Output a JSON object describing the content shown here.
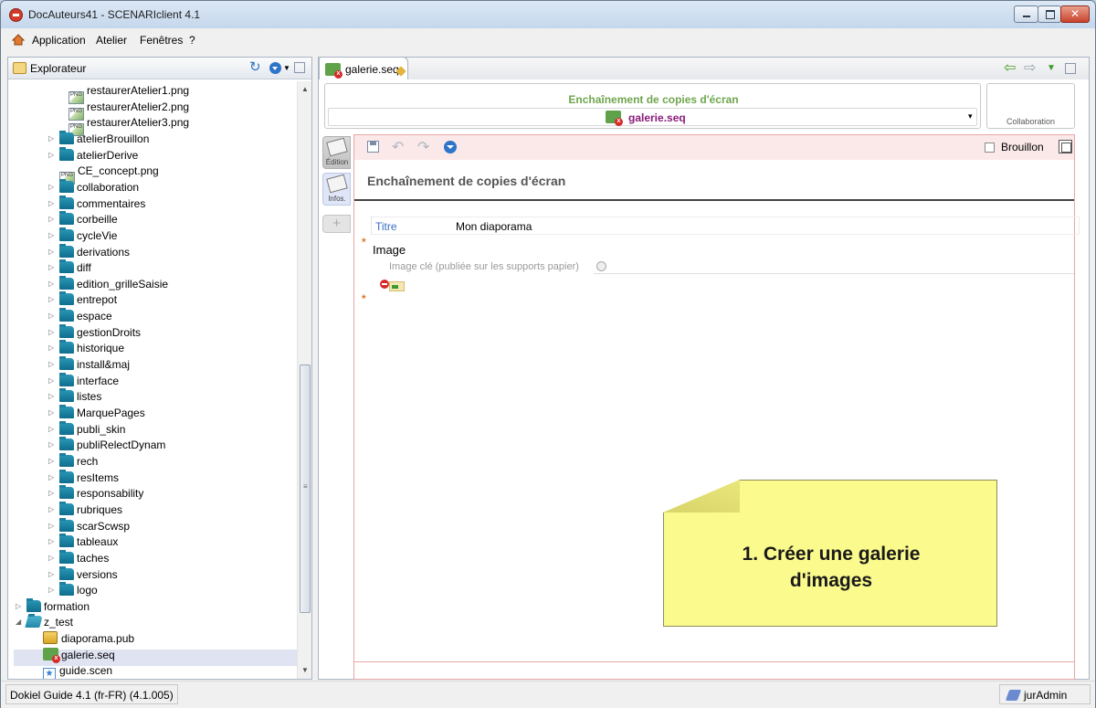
{
  "window": {
    "title": "DocAuteurs41 - SCENARIclient 4.1",
    "close_glyph": "✕"
  },
  "menu": [
    "Application",
    "Atelier",
    "Fenêtres",
    "?"
  ],
  "explorer": {
    "title": "Explorateur",
    "tree": [
      {
        "label": "restaurerAtelier1.png",
        "type": "png",
        "level": 4,
        "twisty": ""
      },
      {
        "label": "restaurerAtelier2.png",
        "type": "png",
        "level": 4,
        "twisty": ""
      },
      {
        "label": "restaurerAtelier3.png",
        "type": "png",
        "level": 4,
        "twisty": ""
      },
      {
        "label": "atelierBrouillon",
        "type": "folder",
        "level": 3,
        "twisty": "▷"
      },
      {
        "label": "atelierDerive",
        "type": "folder",
        "level": 3,
        "twisty": "▷"
      },
      {
        "label": "CE_concept.png",
        "type": "png",
        "level": 3,
        "twisty": ""
      },
      {
        "label": "collaboration",
        "type": "folder",
        "level": 3,
        "twisty": "▷"
      },
      {
        "label": "commentaires",
        "type": "folder",
        "level": 3,
        "twisty": "▷"
      },
      {
        "label": "corbeille",
        "type": "folder",
        "level": 3,
        "twisty": "▷"
      },
      {
        "label": "cycleVie",
        "type": "folder",
        "level": 3,
        "twisty": "▷"
      },
      {
        "label": "derivations",
        "type": "folder",
        "level": 3,
        "twisty": "▷"
      },
      {
        "label": "diff",
        "type": "folder",
        "level": 3,
        "twisty": "▷"
      },
      {
        "label": "edition_grilleSaisie",
        "type": "folder",
        "level": 3,
        "twisty": "▷"
      },
      {
        "label": "entrepot",
        "type": "folder",
        "level": 3,
        "twisty": "▷"
      },
      {
        "label": "espace",
        "type": "folder",
        "level": 3,
        "twisty": "▷"
      },
      {
        "label": "gestionDroits",
        "type": "folder",
        "level": 3,
        "twisty": "▷"
      },
      {
        "label": "historique",
        "type": "folder",
        "level": 3,
        "twisty": "▷"
      },
      {
        "label": "install&maj",
        "type": "folder",
        "level": 3,
        "twisty": "▷"
      },
      {
        "label": "interface",
        "type": "folder",
        "level": 3,
        "twisty": "▷"
      },
      {
        "label": "listes",
        "type": "folder",
        "level": 3,
        "twisty": "▷"
      },
      {
        "label": "MarquePages",
        "type": "folder",
        "level": 3,
        "twisty": "▷"
      },
      {
        "label": "publi_skin",
        "type": "folder",
        "level": 3,
        "twisty": "▷"
      },
      {
        "label": "publiRelectDynam",
        "type": "folder",
        "level": 3,
        "twisty": "▷"
      },
      {
        "label": "rech",
        "type": "folder",
        "level": 3,
        "twisty": "▷"
      },
      {
        "label": "resItems",
        "type": "folder",
        "level": 3,
        "twisty": "▷"
      },
      {
        "label": "responsability",
        "type": "folder",
        "level": 3,
        "twisty": "▷"
      },
      {
        "label": "rubriques",
        "type": "folder",
        "level": 3,
        "twisty": "▷"
      },
      {
        "label": "scarScwsp",
        "type": "folder",
        "level": 3,
        "twisty": "▷"
      },
      {
        "label": "tableaux",
        "type": "folder",
        "level": 3,
        "twisty": "▷"
      },
      {
        "label": "taches",
        "type": "folder",
        "level": 3,
        "twisty": "▷"
      },
      {
        "label": "versions",
        "type": "folder",
        "level": 3,
        "twisty": "▷"
      },
      {
        "label": "logo",
        "type": "folder",
        "level": 2,
        "twisty": "▷"
      },
      {
        "label": "formation",
        "type": "folder",
        "level": 0,
        "twisty": "▷"
      },
      {
        "label": "z_test",
        "type": "folder-open",
        "level": 0,
        "twisty": "◢"
      },
      {
        "label": "diaporama.pub",
        "type": "pub",
        "level": 1,
        "twisty": ""
      },
      {
        "label": "galerie.seq",
        "type": "seq",
        "level": 1,
        "twisty": "",
        "selected": true
      },
      {
        "label": "guide.scen",
        "type": "scen",
        "level": 1,
        "twisty": ""
      }
    ]
  },
  "editor": {
    "tab_label": "galerie.seq",
    "doc_type": "Enchaînement de copies d'écran",
    "doc_file": "galerie.seq",
    "collab_label": "Collaboration",
    "side_tabs": {
      "edit": "Édition",
      "infos": "Infos."
    },
    "draft_label": "Brouillon",
    "model_title": "Enchaînement de copies d'écran",
    "titre_label": "Titre",
    "titre_value": "Mon diaporama",
    "image_label": "Image",
    "keyimg_label": "Image clé (publiée sur les supports papier)"
  },
  "sticky_note": {
    "line1": "1. Créer une galerie",
    "line2": "d'images"
  },
  "status": {
    "left": "Dokiel Guide 4.1 (fr-FR) (4.1.005)",
    "user": "jurAdmin"
  },
  "colors": {
    "doc_type": "#6fa64e",
    "doc_file": "#8a1a7a",
    "note": "#fbfa8c",
    "edit_border": "#e8a6a6"
  }
}
